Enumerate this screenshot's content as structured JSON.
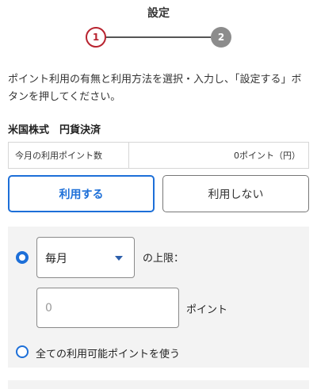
{
  "header": {
    "title": "設定"
  },
  "stepper": {
    "step1": "1",
    "step2": "2",
    "current": 1
  },
  "instruction": "ポイント利用の有無と利用方法を選択・入力し、「設定する」ボタンを押してください。",
  "section": {
    "title": "米国株式　円貨決済"
  },
  "points_table": {
    "label": "今月の利用ポイント数",
    "value": "0ポイント（円）"
  },
  "usage_toggle": {
    "use_label": "利用する",
    "no_use_label": "利用しない",
    "selected": "use"
  },
  "options": {
    "period_select": {
      "value": "毎月"
    },
    "limit_label": "の上限：",
    "amount_input": {
      "value": "",
      "placeholder": "0"
    },
    "unit_label": "ポイント",
    "all_points_label": "全ての利用可能ポイントを使う",
    "selected_option": "limit"
  },
  "colors": {
    "accent_blue": "#1d6fd8",
    "step_active_red": "#b8232f",
    "step_inactive_gray": "#8c8c8c",
    "panel_background": "#f3f3f3"
  }
}
